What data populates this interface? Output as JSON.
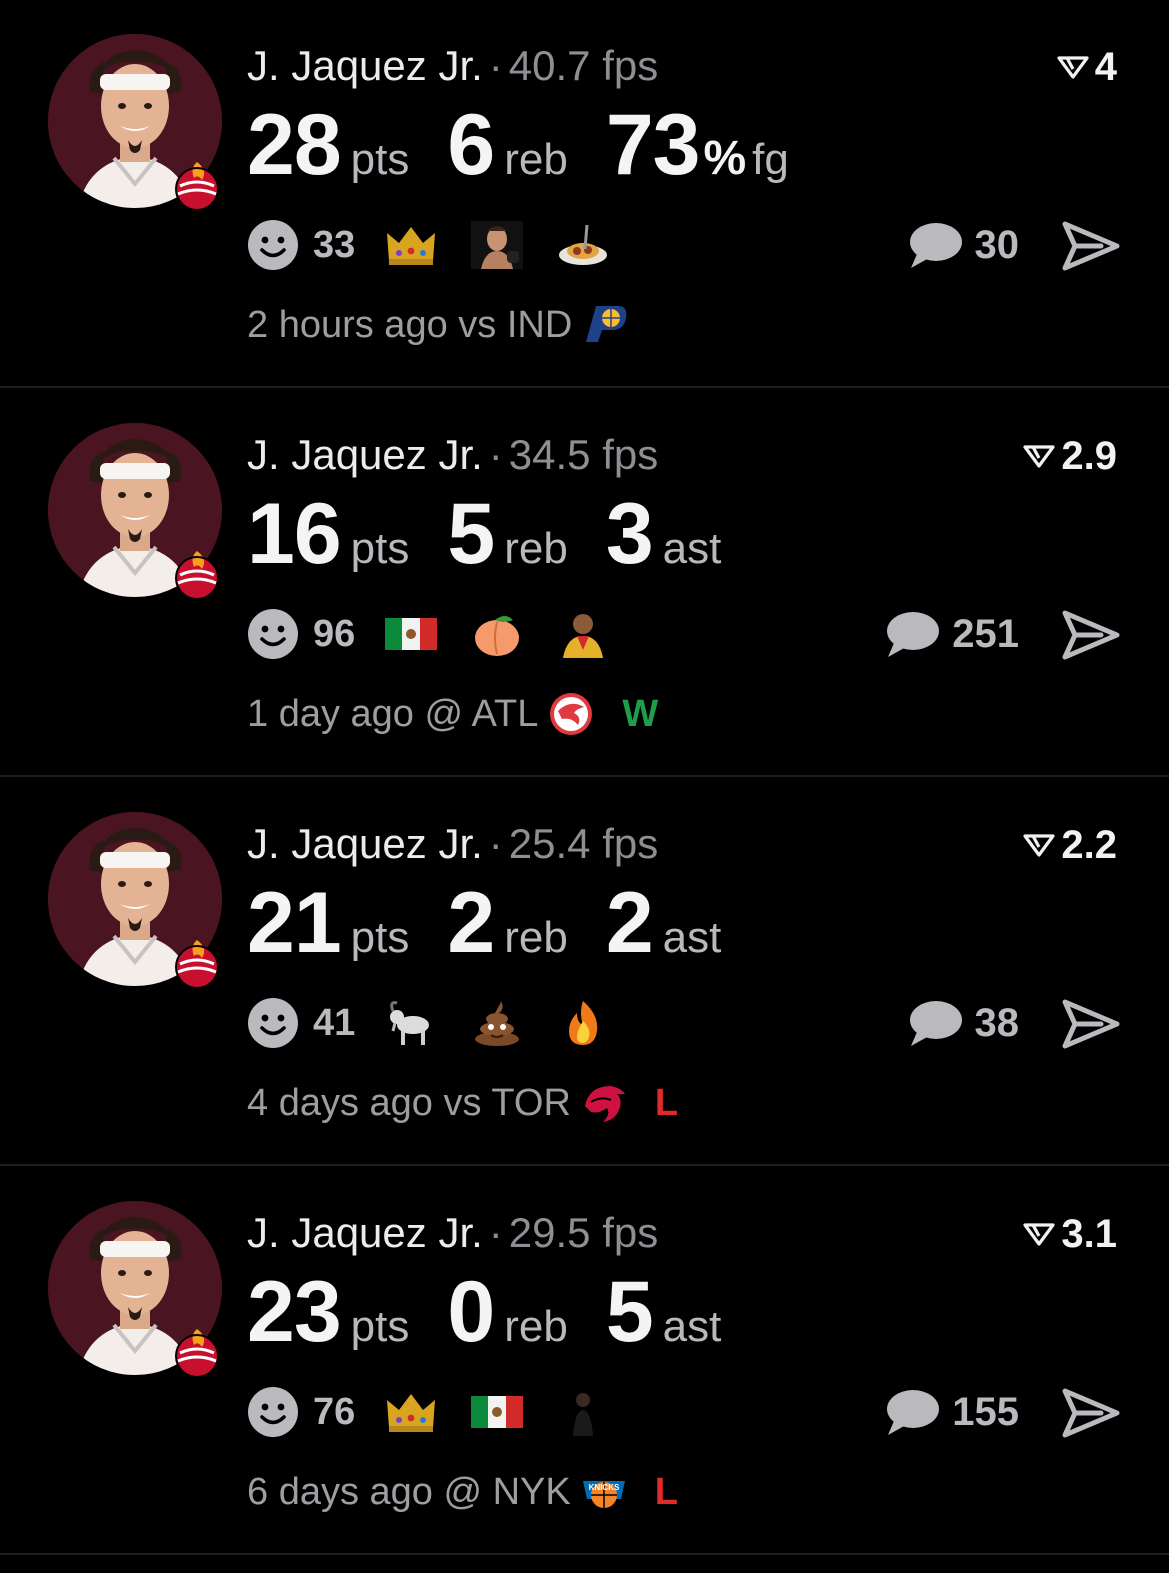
{
  "cards": [
    {
      "player": "J. Jaquez Jr.",
      "separator": "·",
      "fps": "40.7 fps",
      "rating": "4",
      "stats": [
        {
          "value": "28",
          "unit": "pts"
        },
        {
          "value": "6",
          "unit": "reb"
        },
        {
          "value": "73",
          "pct": "%",
          "unit": "fg"
        }
      ],
      "smile_count": "33",
      "reactions": [
        "crown-emoji",
        "fighter-emoji",
        "spaghetti-emoji"
      ],
      "comments": "30",
      "when": "2 hours ago",
      "location": "vs IND",
      "opponent_logo": "pacers-logo",
      "result": ""
    },
    {
      "player": "J. Jaquez Jr.",
      "separator": "·",
      "fps": "34.5 fps",
      "rating": "2.9",
      "stats": [
        {
          "value": "16",
          "unit": "pts"
        },
        {
          "value": "5",
          "unit": "reb"
        },
        {
          "value": "3",
          "unit": "ast"
        }
      ],
      "smile_count": "96",
      "reactions": [
        "mexico-flag-emoji",
        "peach-emoji",
        "person-emoji"
      ],
      "comments": "251",
      "when": "1 day ago",
      "location": "@ ATL",
      "opponent_logo": "hawks-logo",
      "result": "W"
    },
    {
      "player": "J. Jaquez Jr.",
      "separator": "·",
      "fps": "25.4 fps",
      "rating": "2.2",
      "stats": [
        {
          "value": "21",
          "unit": "pts"
        },
        {
          "value": "2",
          "unit": "reb"
        },
        {
          "value": "2",
          "unit": "ast"
        }
      ],
      "smile_count": "41",
      "reactions": [
        "goat-emoji",
        "poop-emoji",
        "fire-emoji"
      ],
      "comments": "38",
      "when": "4 days ago",
      "location": "vs TOR",
      "opponent_logo": "raptors-logo",
      "result": "L"
    },
    {
      "player": "J. Jaquez Jr.",
      "separator": "·",
      "fps": "29.5 fps",
      "rating": "3.1",
      "stats": [
        {
          "value": "23",
          "unit": "pts"
        },
        {
          "value": "0",
          "unit": "reb"
        },
        {
          "value": "5",
          "unit": "ast"
        }
      ],
      "smile_count": "76",
      "reactions": [
        "crown-emoji",
        "mexico-flag-emoji",
        "person-dark-emoji"
      ],
      "comments": "155",
      "when": "6 days ago",
      "location": "@ NYK",
      "opponent_logo": "knicks-logo",
      "result": "L"
    }
  ],
  "colors": {
    "background": "#000000",
    "win": "#1f9e4a",
    "loss": "#e02a2a",
    "avatar_bg": "#4a1420"
  }
}
